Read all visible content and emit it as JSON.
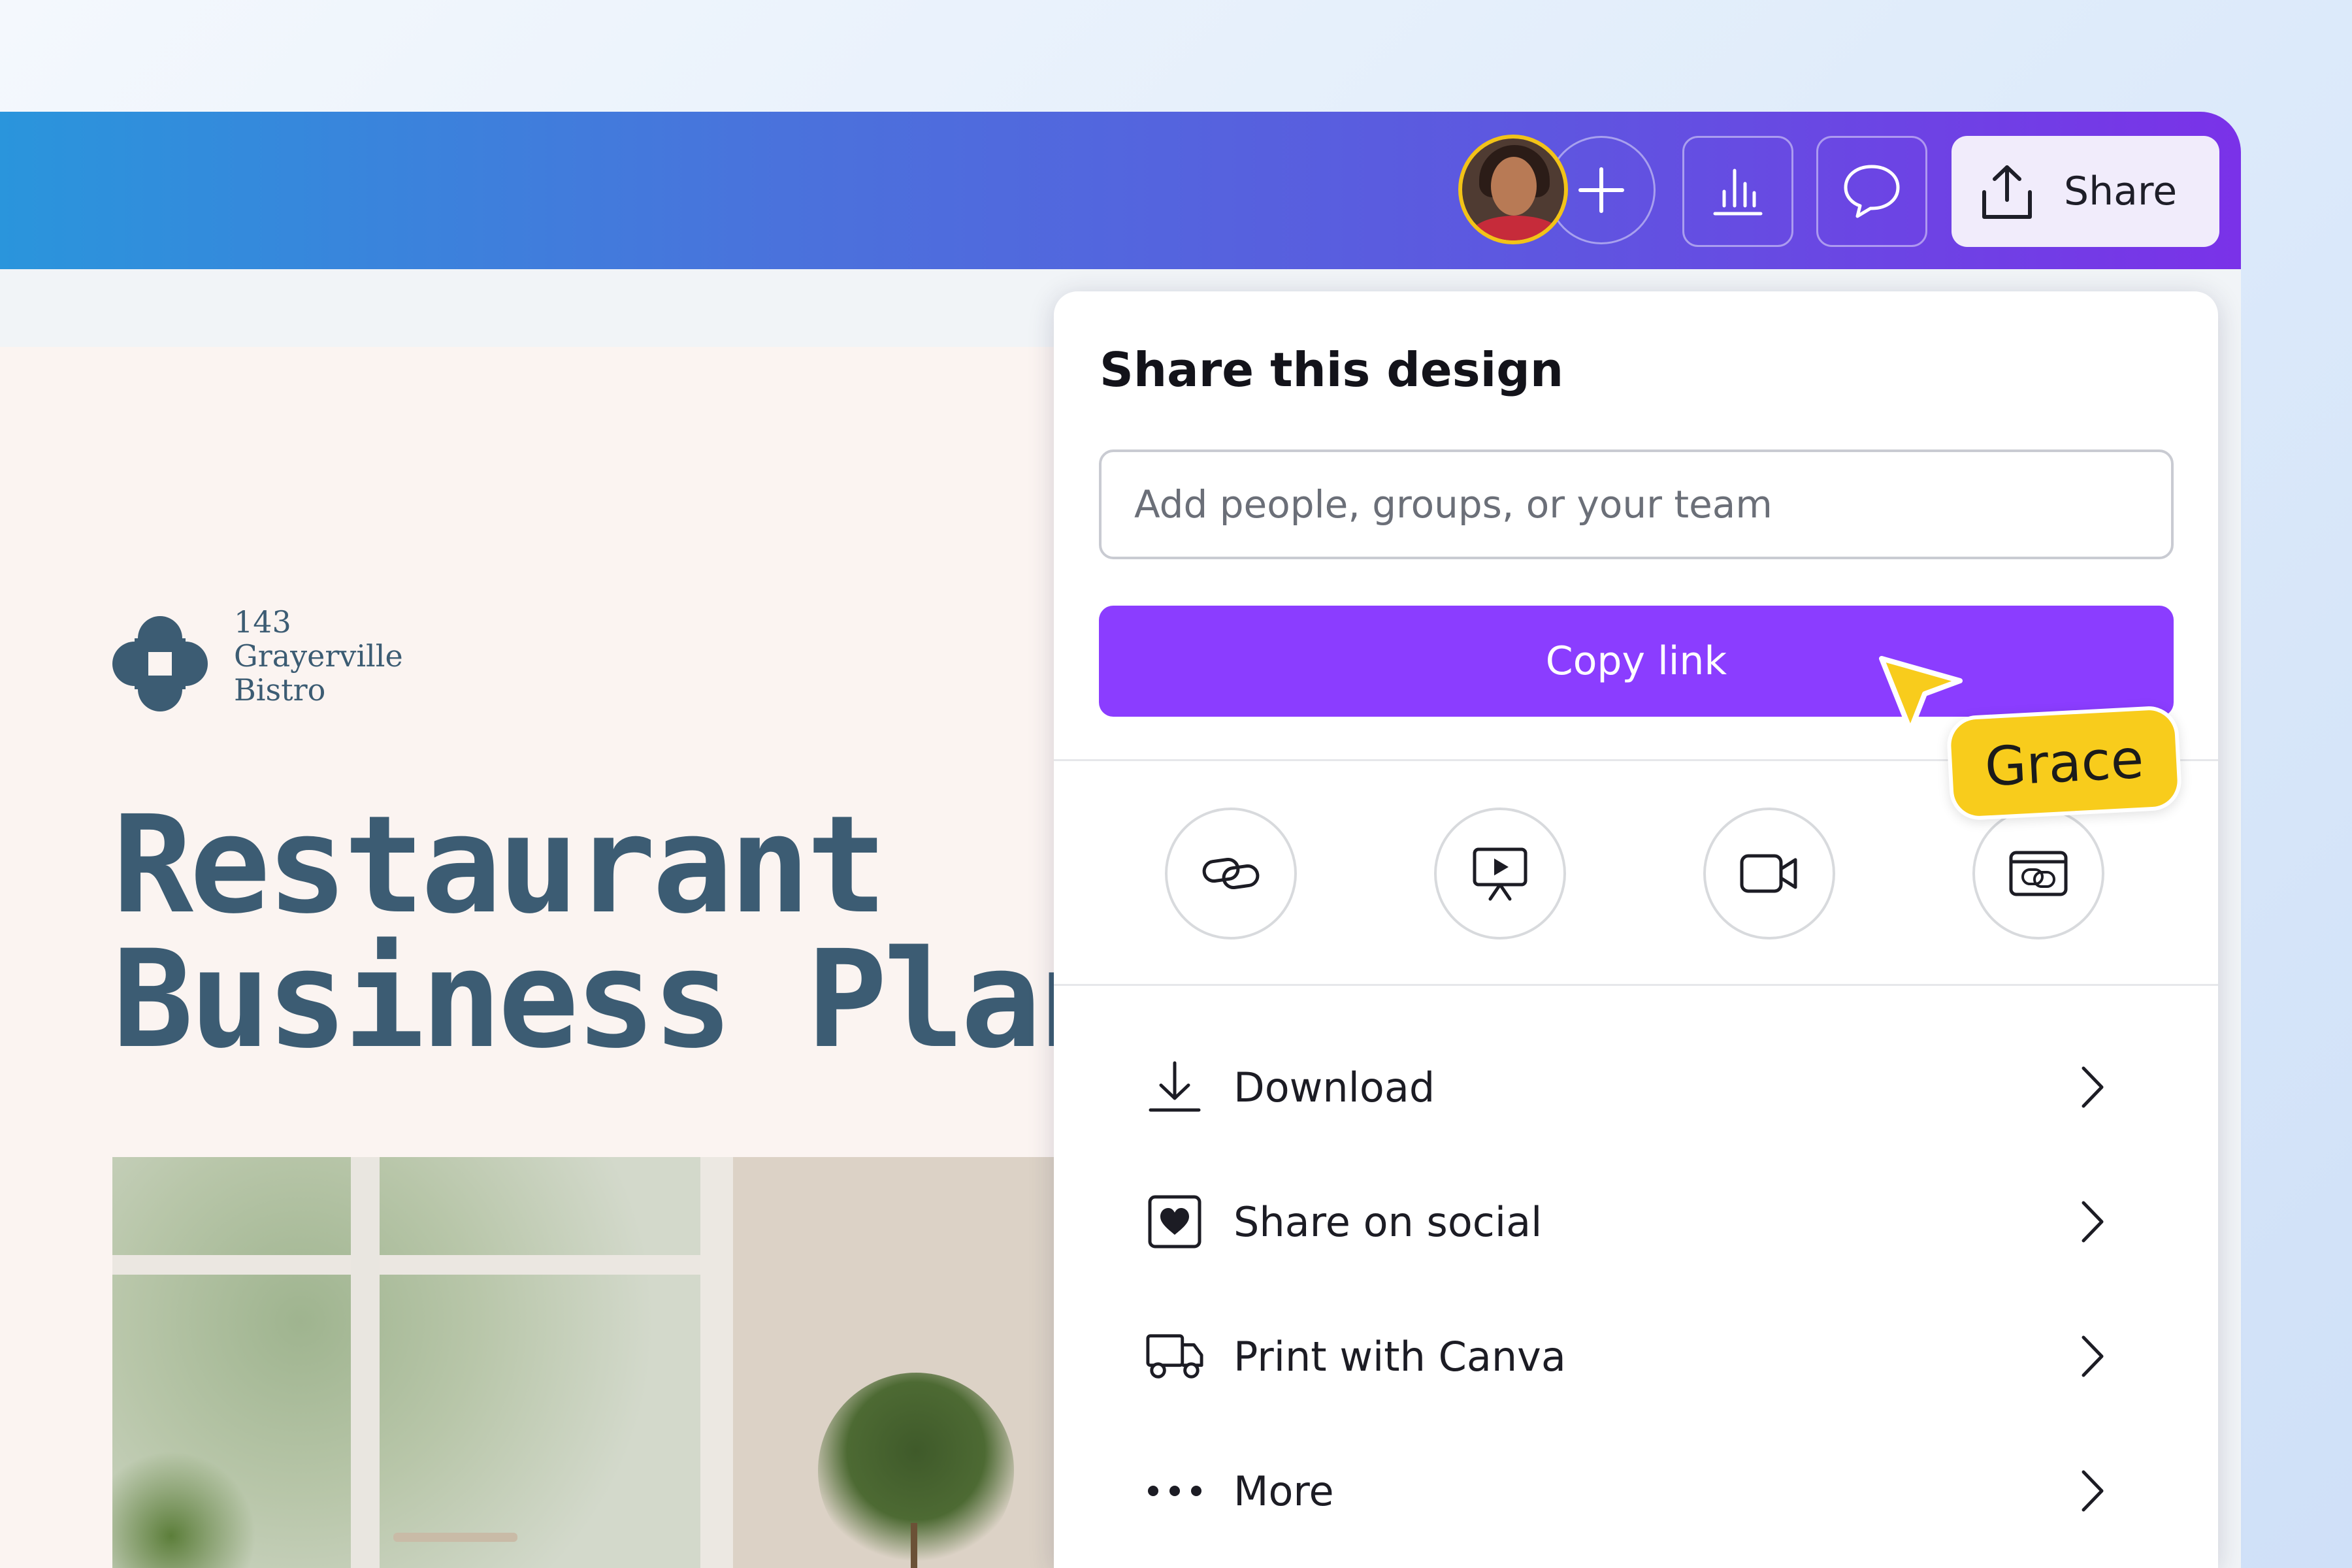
{
  "topbar": {
    "add_label": "+",
    "share_label": "Share",
    "avatar_alt": "Collaborator avatar"
  },
  "design": {
    "logo_lines": [
      "143",
      "Grayerville",
      "Bistro"
    ],
    "headline_lines": [
      "Restaurant",
      "Business Plan"
    ]
  },
  "share_panel": {
    "title": "Share this design",
    "people_input_placeholder": "Add people, groups, or your team",
    "people_input_value": "",
    "copy_link_label": "Copy link",
    "quick_options": [
      {
        "icon": "link-icon"
      },
      {
        "icon": "present-icon"
      },
      {
        "icon": "video-record-icon"
      },
      {
        "icon": "embed-icon"
      }
    ],
    "menu": [
      {
        "icon": "download-icon",
        "label": "Download"
      },
      {
        "icon": "social-heart-icon",
        "label": "Share on social"
      },
      {
        "icon": "truck-icon",
        "label": "Print with Canva"
      },
      {
        "icon": "more-dots-icon",
        "label": "More"
      }
    ]
  },
  "collaborator_cursor": {
    "name": "Grace",
    "color": "#f8cc1c"
  },
  "colors": {
    "accent_purple": "#8b3dff",
    "headline": "#3c5c73",
    "topbar_start": "#2a95dc",
    "topbar_end": "#7a32e8"
  }
}
